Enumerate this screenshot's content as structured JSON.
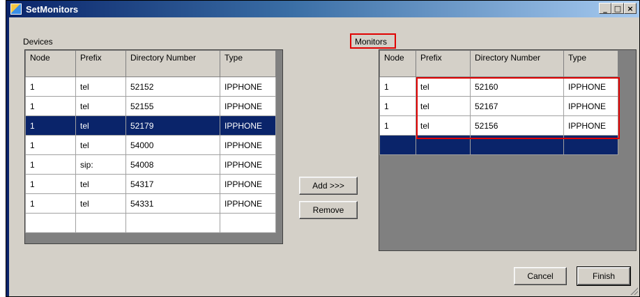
{
  "window": {
    "title": "SetMonitors",
    "controls": [
      "min",
      "max",
      "close"
    ],
    "control_glyphs": {
      "min": "_",
      "max": "□",
      "close": "×"
    }
  },
  "devices": {
    "label": "Devices",
    "columns": [
      "Node",
      "Prefix",
      "Directory Number",
      "Type"
    ],
    "rows": [
      [
        "1",
        "tel",
        "52152",
        "IPPHONE"
      ],
      [
        "1",
        "tel",
        "52155",
        "IPPHONE"
      ],
      [
        "1",
        "tel",
        "52179",
        "IPPHONE"
      ],
      [
        "1",
        "tel",
        "54000",
        "IPPHONE"
      ],
      [
        "1",
        "sip:",
        "54008",
        "IPPHONE"
      ],
      [
        "1",
        "tel",
        "54317",
        "IPPHONE"
      ],
      [
        "1",
        "tel",
        "54331",
        "IPPHONE"
      ]
    ],
    "selected_index": 2
  },
  "monitors": {
    "label": "Monitors",
    "columns": [
      "Node",
      "Prefix",
      "Directory Number",
      "Type"
    ],
    "rows": [
      [
        "1",
        "tel",
        "52160",
        "IPPHONE"
      ],
      [
        "1",
        "tel",
        "52167",
        "IPPHONE"
      ],
      [
        "1",
        "tel",
        "52156",
        "IPPHONE"
      ]
    ]
  },
  "buttons": {
    "add": "Add >>>",
    "remove": "Remove",
    "cancel": "Cancel",
    "finish": "Finish"
  },
  "colors": {
    "selection": "#0a246a",
    "highlight_box": "#e00000",
    "dialog_bg": "#d4d0c8"
  }
}
